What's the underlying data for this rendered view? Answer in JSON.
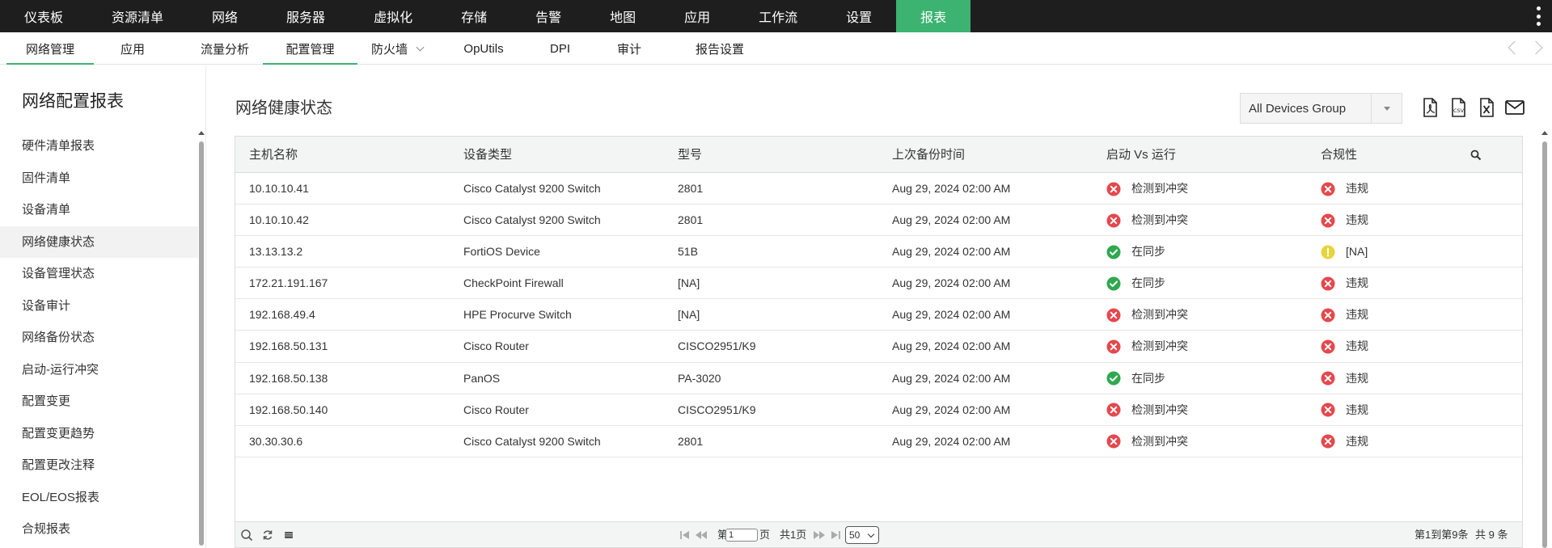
{
  "topnav": {
    "items": [
      {
        "label": "仪表板",
        "active": false
      },
      {
        "label": "资源清单",
        "active": false
      },
      {
        "label": "网络",
        "active": false
      },
      {
        "label": "服务器",
        "active": false
      },
      {
        "label": "虚拟化",
        "active": false
      },
      {
        "label": "存储",
        "active": false
      },
      {
        "label": "告警",
        "active": false
      },
      {
        "label": "地图",
        "active": false
      },
      {
        "label": "应用",
        "active": false
      },
      {
        "label": "工作流",
        "active": false
      },
      {
        "label": "设置",
        "active": false
      },
      {
        "label": "报表",
        "active": true
      }
    ],
    "active_color": "#3cb371"
  },
  "subnav": {
    "tabs": [
      {
        "label": "网络管理",
        "active": true
      },
      {
        "label": "应用",
        "active": false
      },
      {
        "label": "流量分析",
        "active": false
      },
      {
        "label": "配置管理",
        "active": true
      },
      {
        "label": "防火墙",
        "active": false,
        "dropdown": true
      },
      {
        "label": "OpUtils",
        "active": false
      },
      {
        "label": "DPI",
        "active": false
      },
      {
        "label": "审计",
        "active": false
      },
      {
        "label": "报告设置",
        "active": false
      }
    ]
  },
  "sidebar": {
    "title": "网络配置报表",
    "items": [
      {
        "label": "硬件清单报表",
        "active": false
      },
      {
        "label": "固件清单",
        "active": false
      },
      {
        "label": "设备清单",
        "active": false
      },
      {
        "label": "网络健康状态",
        "active": true
      },
      {
        "label": "设备管理状态",
        "active": false
      },
      {
        "label": "设备审计",
        "active": false
      },
      {
        "label": "网络备份状态",
        "active": false
      },
      {
        "label": "启动-运行冲突",
        "active": false
      },
      {
        "label": "配置变更",
        "active": false
      },
      {
        "label": "配置变更趋势",
        "active": false
      },
      {
        "label": "配置更改注释",
        "active": false
      },
      {
        "label": "EOL/EOS报表",
        "active": false
      },
      {
        "label": "合规报表",
        "active": false
      }
    ]
  },
  "main": {
    "title": "网络健康状态",
    "group_select": "All Devices Group",
    "export_icons": [
      "pdf-export-icon",
      "csv-export-icon",
      "excel-export-icon",
      "email-icon"
    ]
  },
  "table": {
    "columns": [
      "主机名称",
      "设备类型",
      "型号",
      "上次备份时间",
      "启动 Vs 运行",
      "合规性"
    ],
    "rows": [
      {
        "host": "10.10.10.41",
        "type": "Cisco Catalyst 9200 Switch",
        "model": "2801",
        "backup": "Aug 29, 2024 02:00 AM",
        "startup": "检测到冲突",
        "startup_status": "error",
        "compliance": "违规",
        "compliance_status": "error"
      },
      {
        "host": "10.10.10.42",
        "type": "Cisco Catalyst 9200 Switch",
        "model": "2801",
        "backup": "Aug 29, 2024 02:00 AM",
        "startup": "检测到冲突",
        "startup_status": "error",
        "compliance": "违规",
        "compliance_status": "error"
      },
      {
        "host": "13.13.13.2",
        "type": "FortiOS Device",
        "model": "51B",
        "backup": "Aug 29, 2024 02:00 AM",
        "startup": "在同步",
        "startup_status": "ok",
        "compliance": "[NA]",
        "compliance_status": "warn"
      },
      {
        "host": "172.21.191.167",
        "type": "CheckPoint Firewall",
        "model": "[NA]",
        "backup": "Aug 29, 2024 02:00 AM",
        "startup": "在同步",
        "startup_status": "ok",
        "compliance": "违规",
        "compliance_status": "error"
      },
      {
        "host": "192.168.49.4",
        "type": "HPE Procurve Switch",
        "model": "[NA]",
        "backup": "Aug 29, 2024 02:00 AM",
        "startup": "检测到冲突",
        "startup_status": "error",
        "compliance": "违规",
        "compliance_status": "error"
      },
      {
        "host": "192.168.50.131",
        "type": "Cisco Router",
        "model": "CISCO2951/K9",
        "backup": "Aug 29, 2024 02:00 AM",
        "startup": "检测到冲突",
        "startup_status": "error",
        "compliance": "违规",
        "compliance_status": "error"
      },
      {
        "host": "192.168.50.138",
        "type": "PanOS",
        "model": "PA-3020",
        "backup": "Aug 29, 2024 02:00 AM",
        "startup": "在同步",
        "startup_status": "ok",
        "compliance": "违规",
        "compliance_status": "error"
      },
      {
        "host": "192.168.50.140",
        "type": "Cisco Router",
        "model": "CISCO2951/K9",
        "backup": "Aug 29, 2024 02:00 AM",
        "startup": "检测到冲突",
        "startup_status": "error",
        "compliance": "违规",
        "compliance_status": "error"
      },
      {
        "host": "30.30.30.6",
        "type": "Cisco Catalyst 9200 Switch",
        "model": "2801",
        "backup": "Aug 29, 2024 02:00 AM",
        "startup": "检测到冲突",
        "startup_status": "error",
        "compliance": "违规",
        "compliance_status": "error"
      }
    ]
  },
  "pager": {
    "page_prefix": "第",
    "page_value": "1",
    "page_suffix": "页",
    "total_pages": "共1页",
    "page_size": "50",
    "summary": "第1到第9条",
    "total": "共 9 条"
  },
  "colors": {
    "error": "#e5484d",
    "ok": "#2fa84f",
    "warn": "#e8d33a",
    "accent": "#3cb371"
  }
}
